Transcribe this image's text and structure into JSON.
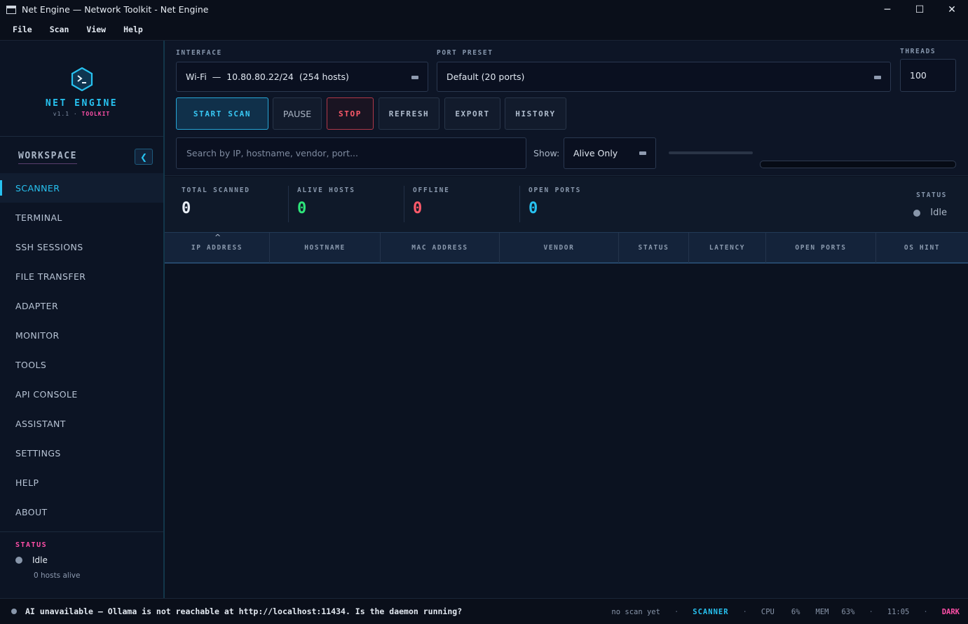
{
  "window": {
    "title": "Net Engine — Network Toolkit - Net Engine",
    "controls": {
      "minimize": "─",
      "maximize": "☐",
      "close": "✕"
    }
  },
  "menu": [
    "File",
    "Scan",
    "View",
    "Help"
  ],
  "brand": {
    "name": "NET ENGINE",
    "version": "v1.1",
    "dot": "·",
    "tag": "TOOLKIT",
    "logo_icon": "terminal-hex-icon"
  },
  "sidebar": {
    "workspace_label": "WORKSPACE",
    "collapse_glyph": "❮",
    "items": [
      {
        "label": "SCANNER",
        "active": true
      },
      {
        "label": "TERMINAL"
      },
      {
        "label": "SSH SESSIONS"
      },
      {
        "label": "FILE TRANSFER"
      },
      {
        "label": "ADAPTER"
      },
      {
        "label": "MONITOR"
      },
      {
        "label": "TOOLS"
      },
      {
        "label": "API CONSOLE"
      },
      {
        "label": "ASSISTANT"
      },
      {
        "label": "SETTINGS"
      },
      {
        "label": "HELP"
      },
      {
        "label": "ABOUT"
      }
    ],
    "status": {
      "label": "STATUS",
      "state": "Idle",
      "hosts": "0 hosts alive"
    }
  },
  "toolbar": {
    "interface_label": "INTERFACE",
    "interface_value": "Wi-Fi  —  10.80.80.22/24  (254 hosts)",
    "port_preset_label": "PORT PRESET",
    "port_preset_value": "Default (20 ports)",
    "threads_label": "THREADS",
    "threads_value": "100",
    "buttons": {
      "start": "START SCAN",
      "pause": "PAUSE",
      "stop": "STOP",
      "refresh": "REFRESH",
      "export": "EXPORT",
      "history": "HISTORY"
    },
    "search_placeholder": "Search by IP, hostname, vendor, port...",
    "show_label": "Show:",
    "show_value": "Alive Only",
    "progress": 0
  },
  "stats": {
    "total_scanned": {
      "label": "TOTAL SCANNED",
      "value": "0",
      "color": "#e8eef6"
    },
    "alive_hosts": {
      "label": "ALIVE HOSTS",
      "value": "0",
      "color": "#2ee57a"
    },
    "offline": {
      "label": "OFFLINE",
      "value": "0",
      "color": "#ff5a6a"
    },
    "open_ports": {
      "label": "OPEN PORTS",
      "value": "0",
      "color": "#27c2f0"
    },
    "status": {
      "label": "STATUS",
      "state": "Idle"
    }
  },
  "table": {
    "sort_indicator": "^",
    "columns": [
      "IP ADDRESS",
      "HOSTNAME",
      "MAC ADDRESS",
      "VENDOR",
      "STATUS",
      "LATENCY",
      "OPEN PORTS",
      "OS HINT"
    ],
    "rows": []
  },
  "statusbar": {
    "message": "AI unavailable — Ollama is not reachable at http://localhost:11434. Is the daemon running?",
    "scan": "no scan yet",
    "sep": "·",
    "view": "SCANNER",
    "cpu_label": "CPU",
    "cpu_value": "6%",
    "mem_label": "MEM",
    "mem_value": "63%",
    "time": "11:05",
    "theme": "DARK"
  },
  "colors": {
    "accent": "#27c2f0",
    "pink": "#ff4fa8",
    "danger": "#ff5a6a",
    "success": "#2ee57a"
  }
}
